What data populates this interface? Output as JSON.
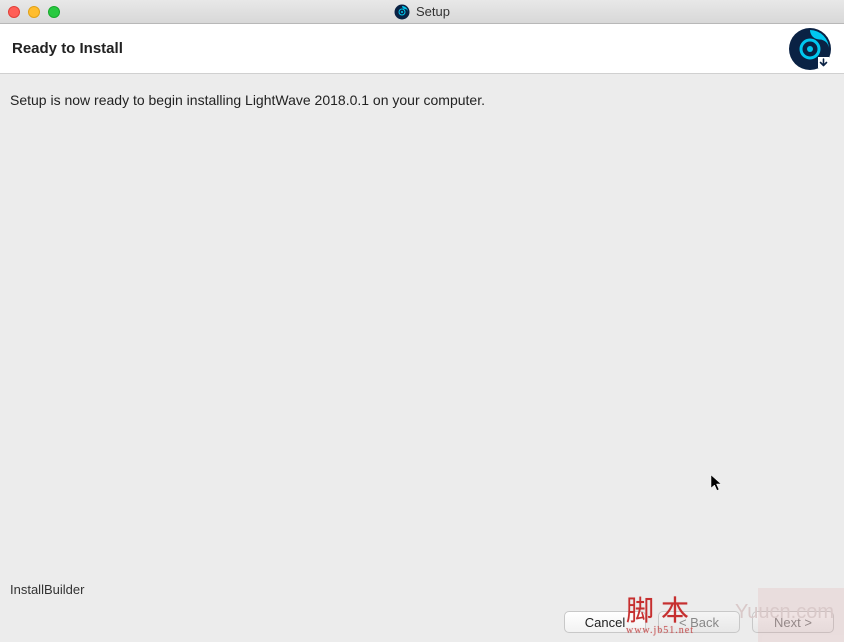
{
  "titlebar": {
    "title": "Setup"
  },
  "header": {
    "page_title": "Ready to Install"
  },
  "content": {
    "message": "Setup is now ready to begin installing LightWave 2018.0.1 on your computer."
  },
  "footer": {
    "builder": "InstallBuilder",
    "cancel_label": "Cancel",
    "back_label": "< Back",
    "next_label": "Next >"
  },
  "watermark": {
    "text_a": "脚 本",
    "sub_a": "www.jb51.net",
    "text_b": "Yuucn.com"
  }
}
